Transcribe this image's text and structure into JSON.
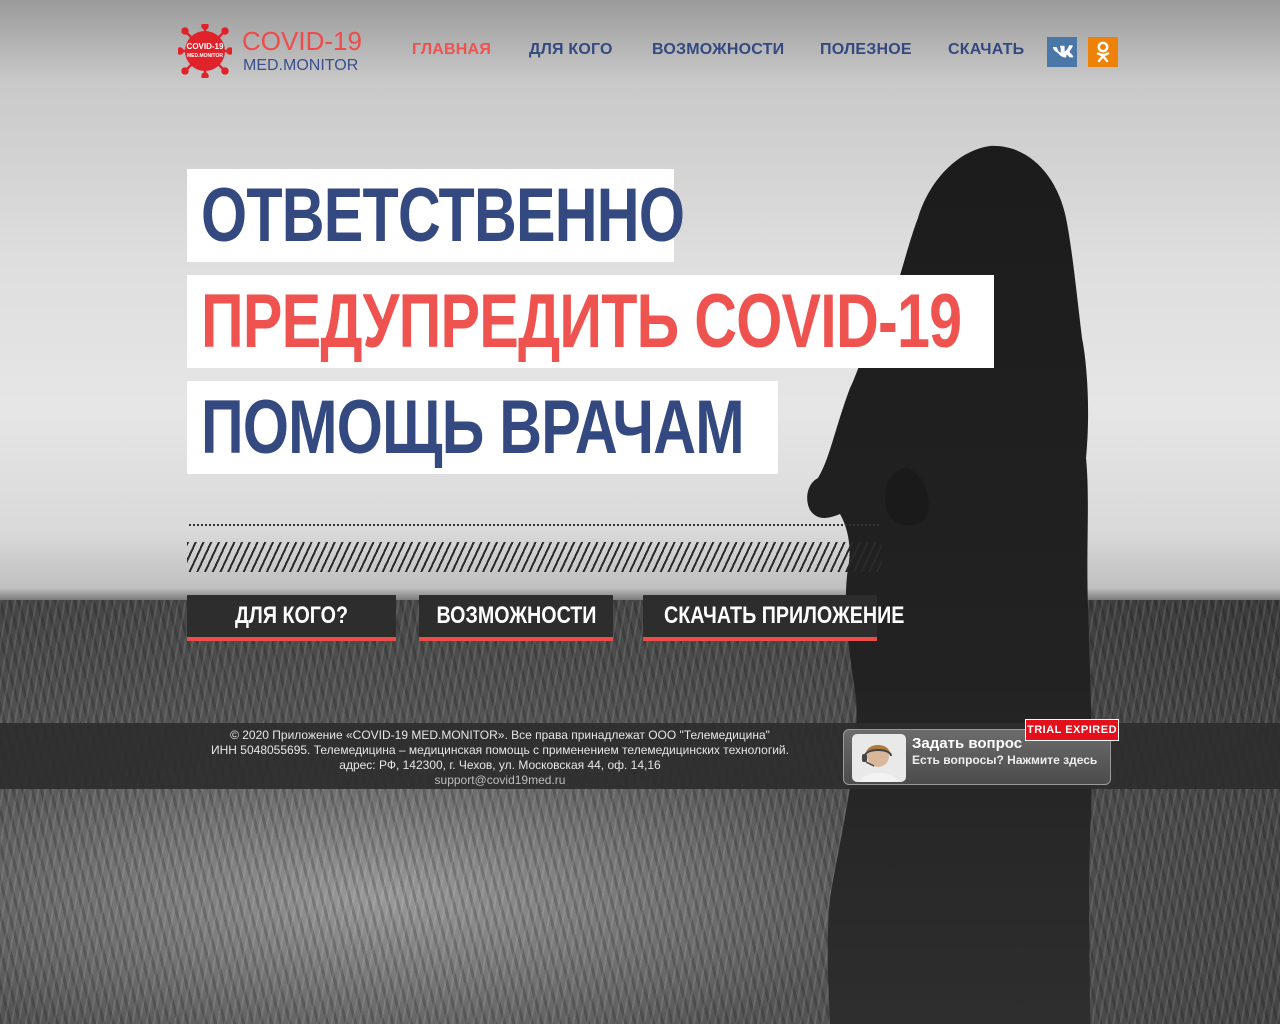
{
  "brand": {
    "logo_badge_line1": "COVID-19",
    "logo_badge_line2": "MED.MONITOR",
    "title": "COVID-19",
    "subtitle": "MED.MONITOR",
    "accent_red": "#ef4b4b",
    "accent_blue": "#34497f"
  },
  "nav": {
    "items": [
      {
        "label": "ГЛАВНАЯ",
        "active": true
      },
      {
        "label": "ДЛЯ КОГО",
        "active": false
      },
      {
        "label": "ВОЗМОЖНОСТИ",
        "active": false
      },
      {
        "label": "ПОЛЕЗНОЕ",
        "active": false
      },
      {
        "label": "СКАЧАТЬ",
        "active": false
      }
    ]
  },
  "social": {
    "vk_icon": "vk-icon",
    "ok_icon": "odnoklassniki-icon"
  },
  "hero": {
    "line1": "ОТВЕТСТВЕННО",
    "line2": "ПРЕДУПРЕДИТЬ COVID-19",
    "line3": "ПОМОЩЬ ВРАЧАМ"
  },
  "cta": {
    "for_whom": "ДЛЯ КОГО?",
    "features": "ВОЗМОЖНОСТИ",
    "download": "СКАЧАТЬ ПРИЛОЖЕНИЕ"
  },
  "footer": {
    "line1": "© 2020 Приложение «COVID-19 MED.MONITOR». Все права принадлежат ООО \"Телемедицина\"",
    "line2": "ИНН 5048055695.  Телемедицина – медицинская помощь с применением телемедицинских технологий.",
    "line3": "адрес: РФ, 142300, г. Чехов, ул. Московская 44, оф. 14,16",
    "email": "support@covid19med.ru"
  },
  "ask_widget": {
    "title": "Задать вопрос",
    "subtitle": "Есть вопросы? Нажмите здесь",
    "badge": "TRIAL EXPIRED"
  }
}
